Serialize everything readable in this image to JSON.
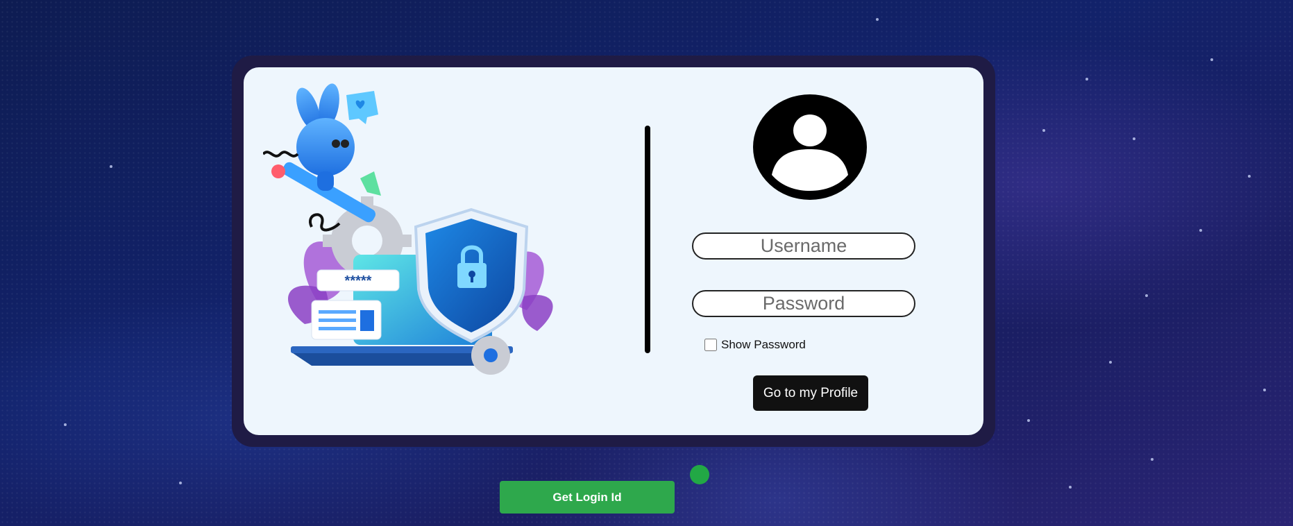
{
  "login": {
    "username_placeholder": "Username",
    "password_placeholder": "Password",
    "show_password_label": "Show Password",
    "profile_button_label": "Go to my Profile",
    "password_mask": "*****"
  },
  "footer": {
    "login_id_button_label": "Get Login Id"
  },
  "icons": {
    "avatar": "user-avatar-icon",
    "shield": "shield-lock-icon",
    "gear": "gear-icon",
    "laptop": "laptop-icon"
  },
  "colors": {
    "background": "#12226a",
    "card_frame": "#1f1b45",
    "card": "#eef6fd",
    "profile_button": "#111111",
    "login_id_button": "#2ea84c",
    "status_dot": "#22a845"
  }
}
